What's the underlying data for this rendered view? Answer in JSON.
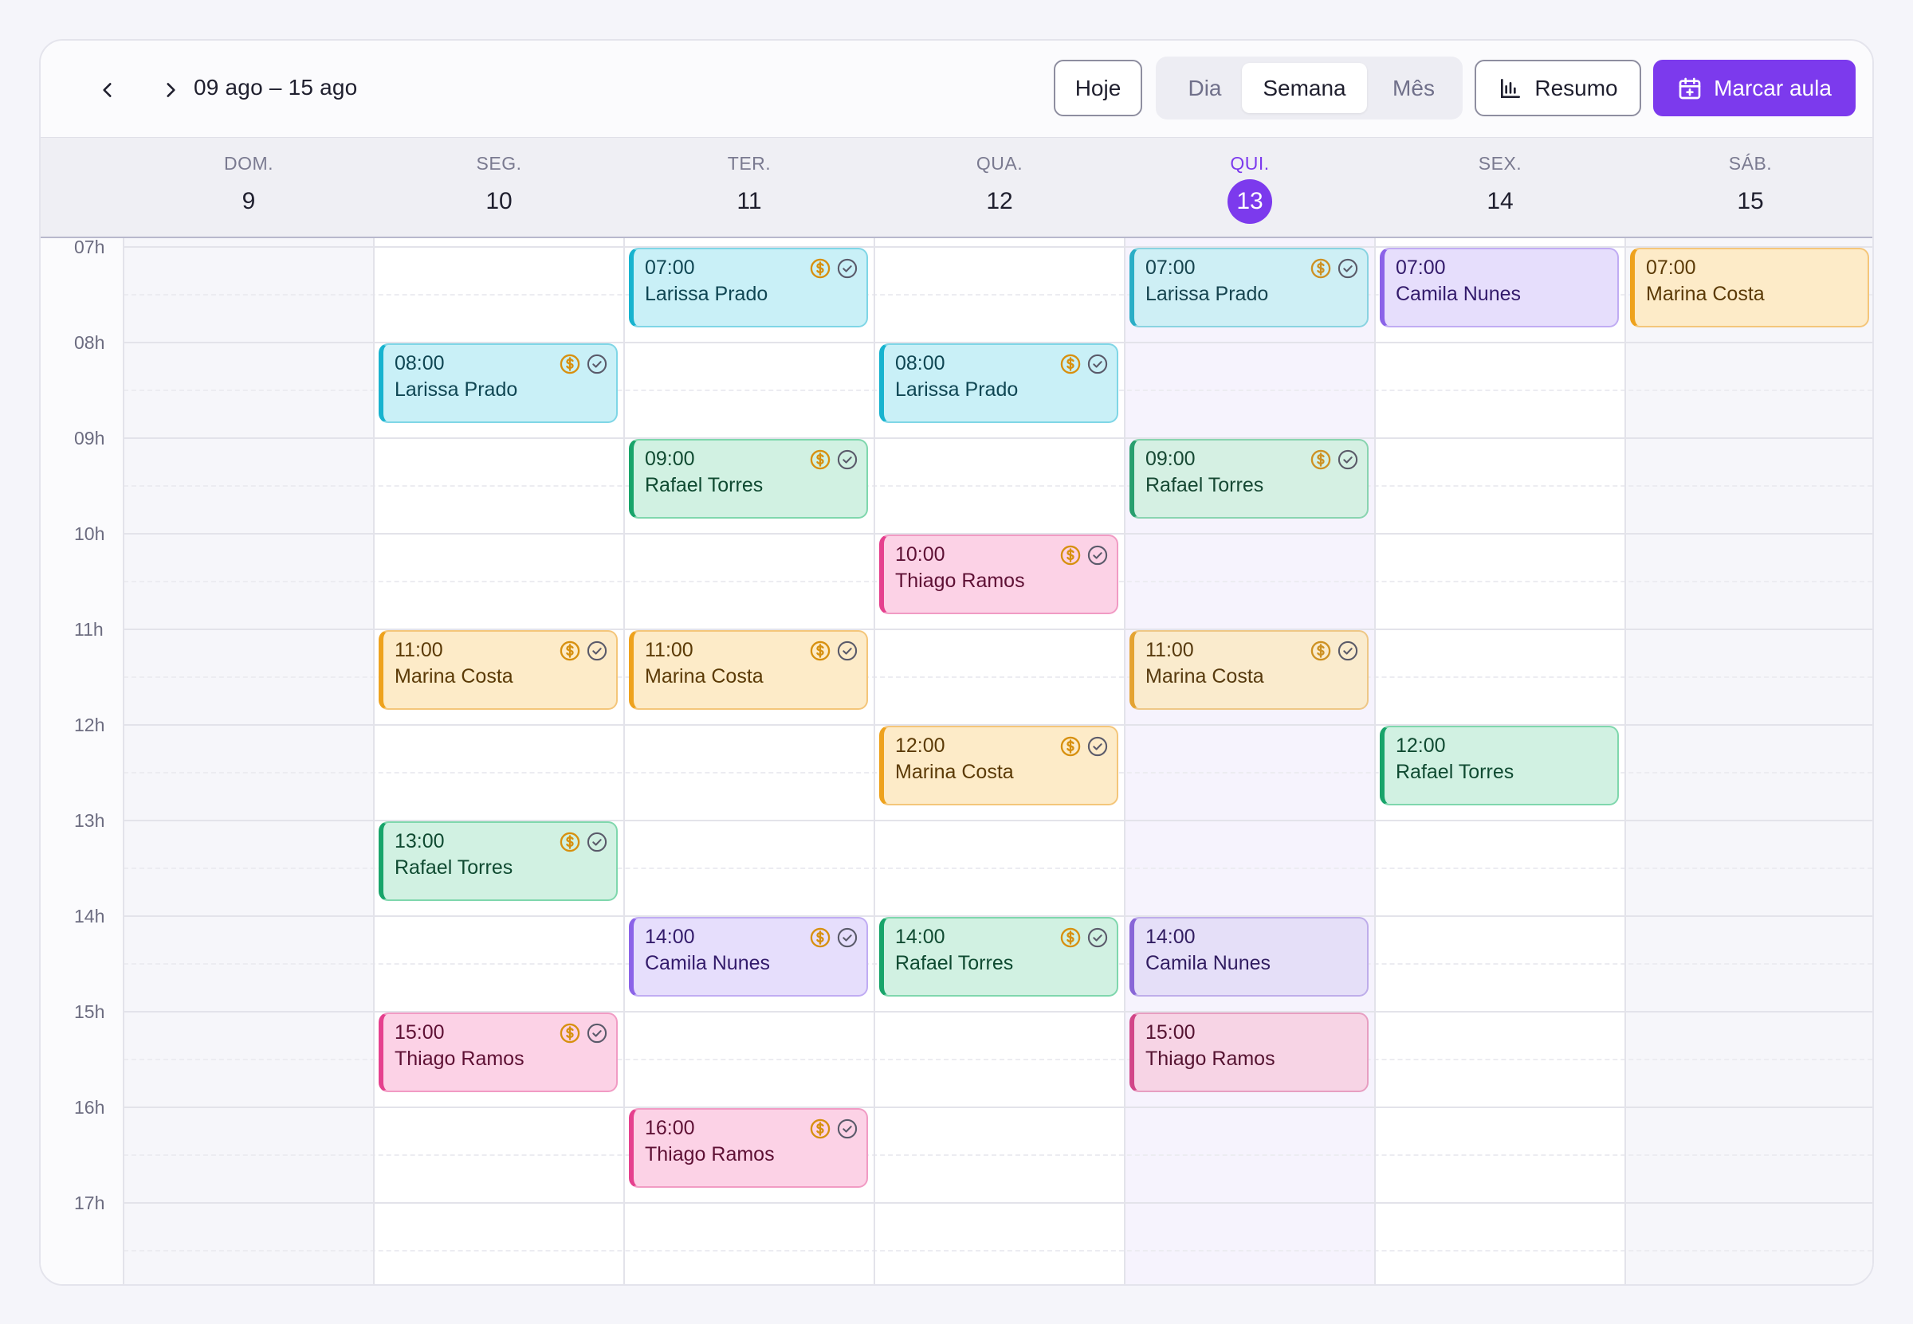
{
  "toolbar": {
    "range_label": "09 ago – 15 ago",
    "today_label": "Hoje",
    "views": [
      "Dia",
      "Semana",
      "Mês"
    ],
    "active_view": "Semana",
    "summary_label": "Resumo",
    "book_label": "Marcar aula"
  },
  "colors": {
    "accent": "#7c3aed",
    "Larissa Prado": {
      "bg": "#c9f0f7",
      "border": "#7fd6e6",
      "bar": "#17b3cf",
      "text": "#0f4653"
    },
    "Rafael Torres": {
      "bg": "#d1f1e2",
      "border": "#7fd7ad",
      "bar": "#18a46a",
      "text": "#0f4a31"
    },
    "Marina Costa": {
      "bg": "#fdebc8",
      "border": "#f4c67a",
      "bar": "#eea21d",
      "text": "#5b3a06"
    },
    "Thiago Ramos": {
      "bg": "#fcd2e6",
      "border": "#f19bc4",
      "bar": "#e5408e",
      "text": "#5e1034"
    },
    "Camila Nunes": {
      "bg": "#e6defc",
      "border": "#c0acf3",
      "bar": "#8b63e8",
      "text": "#331b6b"
    }
  },
  "days": [
    {
      "name": "DOM.",
      "num": "9"
    },
    {
      "name": "SEG.",
      "num": "10"
    },
    {
      "name": "TER.",
      "num": "11"
    },
    {
      "name": "QUA.",
      "num": "12"
    },
    {
      "name": "QUI.",
      "num": "13",
      "today": true
    },
    {
      "name": "SEX.",
      "num": "14"
    },
    {
      "name": "SÁB.",
      "num": "15"
    }
  ],
  "hours": [
    "07h",
    "08h",
    "09h",
    "10h",
    "11h",
    "12h",
    "13h",
    "14h",
    "15h",
    "16h",
    "17h"
  ],
  "events": [
    {
      "day": 2,
      "start": 7,
      "time": "07:00",
      "name": "Larissa Prado",
      "icons": true
    },
    {
      "day": 4,
      "start": 7,
      "time": "07:00",
      "name": "Larissa Prado",
      "icons": true
    },
    {
      "day": 5,
      "start": 7,
      "time": "07:00",
      "name": "Camila Nunes",
      "icons": false
    },
    {
      "day": 6,
      "start": 7,
      "time": "07:00",
      "name": "Marina Costa",
      "icons": false
    },
    {
      "day": 1,
      "start": 8,
      "time": "08:00",
      "name": "Larissa Prado",
      "icons": true
    },
    {
      "day": 3,
      "start": 8,
      "time": "08:00",
      "name": "Larissa Prado",
      "icons": true
    },
    {
      "day": 2,
      "start": 9,
      "time": "09:00",
      "name": "Rafael Torres",
      "icons": true
    },
    {
      "day": 4,
      "start": 9,
      "time": "09:00",
      "name": "Rafael Torres",
      "icons": true
    },
    {
      "day": 3,
      "start": 10,
      "time": "10:00",
      "name": "Thiago Ramos",
      "icons": true
    },
    {
      "day": 1,
      "start": 11,
      "time": "11:00",
      "name": "Marina Costa",
      "icons": true
    },
    {
      "day": 2,
      "start": 11,
      "time": "11:00",
      "name": "Marina Costa",
      "icons": true
    },
    {
      "day": 4,
      "start": 11,
      "time": "11:00",
      "name": "Marina Costa",
      "icons": true
    },
    {
      "day": 3,
      "start": 12,
      "time": "12:00",
      "name": "Marina Costa",
      "icons": true
    },
    {
      "day": 5,
      "start": 12,
      "time": "12:00",
      "name": "Rafael Torres",
      "icons": false
    },
    {
      "day": 1,
      "start": 13,
      "time": "13:00",
      "name": "Rafael Torres",
      "icons": true
    },
    {
      "day": 2,
      "start": 14,
      "time": "14:00",
      "name": "Camila Nunes",
      "icons": true
    },
    {
      "day": 3,
      "start": 14,
      "time": "14:00",
      "name": "Rafael Torres",
      "icons": true
    },
    {
      "day": 4,
      "start": 14,
      "time": "14:00",
      "name": "Camila Nunes",
      "icons": false
    },
    {
      "day": 1,
      "start": 15,
      "time": "15:00",
      "name": "Thiago Ramos",
      "icons": true
    },
    {
      "day": 4,
      "start": 15,
      "time": "15:00",
      "name": "Thiago Ramos",
      "icons": false
    },
    {
      "day": 2,
      "start": 16,
      "time": "16:00",
      "name": "Thiago Ramos",
      "icons": true
    }
  ]
}
